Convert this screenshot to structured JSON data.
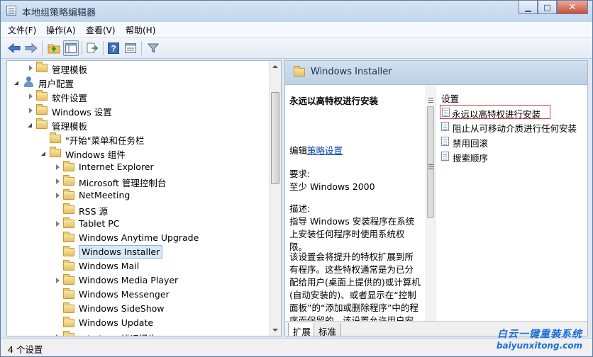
{
  "window": {
    "title": "本地组策略编辑器",
    "minimize": "▁",
    "maximize": "□",
    "close": "✕"
  },
  "menu": [
    "文件(F)",
    "操作(A)",
    "查看(V)",
    "帮助(H)"
  ],
  "toolbar": {
    "icons": [
      "back-arrow-icon",
      "forward-arrow-icon",
      "up-folder-icon",
      "show-tree-icon",
      "export-list-icon",
      "help-icon",
      "properties-icon",
      "filter-icon"
    ]
  },
  "tree": [
    {
      "label": "管理模板",
      "level": 1,
      "toggle": "collapsed",
      "icon": "folder"
    },
    {
      "label": "用户配置",
      "level": 0,
      "toggle": "expanded",
      "icon": "user"
    },
    {
      "label": "软件设置",
      "level": 1,
      "toggle": "collapsed",
      "icon": "folder"
    },
    {
      "label": "Windows 设置",
      "level": 1,
      "toggle": "collapsed",
      "icon": "folder"
    },
    {
      "label": "管理模板",
      "level": 1,
      "toggle": "expanded",
      "icon": "folder"
    },
    {
      "label": "\"开始\"菜单和任务栏",
      "level": 2,
      "toggle": "none",
      "icon": "folder"
    },
    {
      "label": "Windows 组件",
      "level": 2,
      "toggle": "expanded",
      "icon": "folder"
    },
    {
      "label": "Internet Explorer",
      "level": 3,
      "toggle": "collapsed",
      "icon": "folder"
    },
    {
      "label": "Microsoft 管理控制台",
      "level": 3,
      "toggle": "collapsed",
      "icon": "folder"
    },
    {
      "label": "NetMeeting",
      "level": 3,
      "toggle": "collapsed",
      "icon": "folder"
    },
    {
      "label": "RSS 源",
      "level": 3,
      "toggle": "none",
      "icon": "folder"
    },
    {
      "label": "Tablet PC",
      "level": 3,
      "toggle": "collapsed",
      "icon": "folder"
    },
    {
      "label": "Windows Anytime Upgrade",
      "level": 3,
      "toggle": "none",
      "icon": "folder"
    },
    {
      "label": "Windows Installer",
      "level": 3,
      "toggle": "none",
      "icon": "folder",
      "selected": true
    },
    {
      "label": "Windows Mail",
      "level": 3,
      "toggle": "none",
      "icon": "folder"
    },
    {
      "label": "Windows Media Player",
      "level": 3,
      "toggle": "collapsed",
      "icon": "folder"
    },
    {
      "label": "Windows Messenger",
      "level": 3,
      "toggle": "none",
      "icon": "folder"
    },
    {
      "label": "Windows SideShow",
      "level": 3,
      "toggle": "none",
      "icon": "folder"
    },
    {
      "label": "Windows Update",
      "level": 3,
      "toggle": "none",
      "icon": "folder"
    },
    {
      "label": "Windows 错误报告",
      "level": 3,
      "toggle": "collapsed",
      "icon": "folder"
    }
  ],
  "right": {
    "header": "Windows Installer",
    "desc_title": "永远以高特权进行安装",
    "edit_prefix": "编辑",
    "edit_link": "策略设置",
    "req_label": "要求:",
    "req_value": "至少 Windows 2000",
    "desc_label": "描述:",
    "desc_text": "指导 Windows 安装程序在系统上安装任何程序时使用系统权限。",
    "desc_body": "该设置会将提升的特权扩展到所有程序。这些特权通常是为已分配给用户(桌面上提供的)或计算机(自动安装的)、或者显示在“控制面板”的“添加或删除程序”中的程序而保留的。该设置允许用户安装需要访问用户可能无查看或更改权限目录(包括受高度限制的计算机上的目",
    "column_header": "设置",
    "settings": [
      {
        "label": "永远以高特权进行安装",
        "highlighted": true
      },
      {
        "label": "阻止从可移动介质进行任何安装",
        "highlighted": false
      },
      {
        "label": "禁用回滚",
        "highlighted": false
      },
      {
        "label": "搜索顺序",
        "highlighted": false
      }
    ],
    "tabs": [
      "扩展",
      "标准"
    ]
  },
  "status": "4 个设置",
  "watermark": {
    "brand": "白云一键重装系统",
    "url": "baiyunxitong.com"
  }
}
